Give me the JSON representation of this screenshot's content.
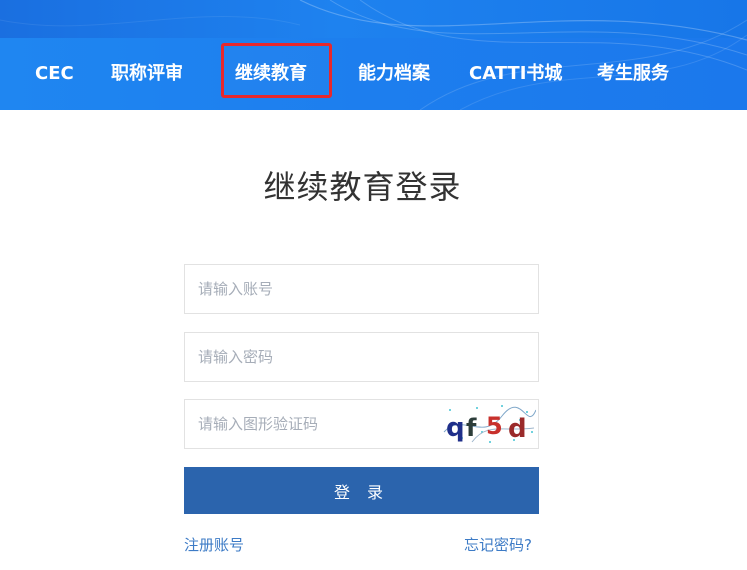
{
  "nav": {
    "items": [
      {
        "label": "CEC"
      },
      {
        "label": "职称评审"
      },
      {
        "label": "继续教育"
      },
      {
        "label": "能力档案"
      },
      {
        "label": "CATTI书城"
      },
      {
        "label": "考生服务"
      }
    ],
    "active_index": 2
  },
  "login": {
    "title": "继续教育登录",
    "account_placeholder": "请输入账号",
    "password_placeholder": "请输入密码",
    "captcha_placeholder": "请输入图形验证码",
    "captcha_text": "qf5d",
    "submit_label": "登 录",
    "register_link": "注册账号",
    "forgot_link": "忘记密码?"
  },
  "colors": {
    "header_blue": "#1d7eee",
    "highlight_red": "#e8282c",
    "button_blue": "#2b64ad",
    "link_blue": "#3d7bc6"
  }
}
